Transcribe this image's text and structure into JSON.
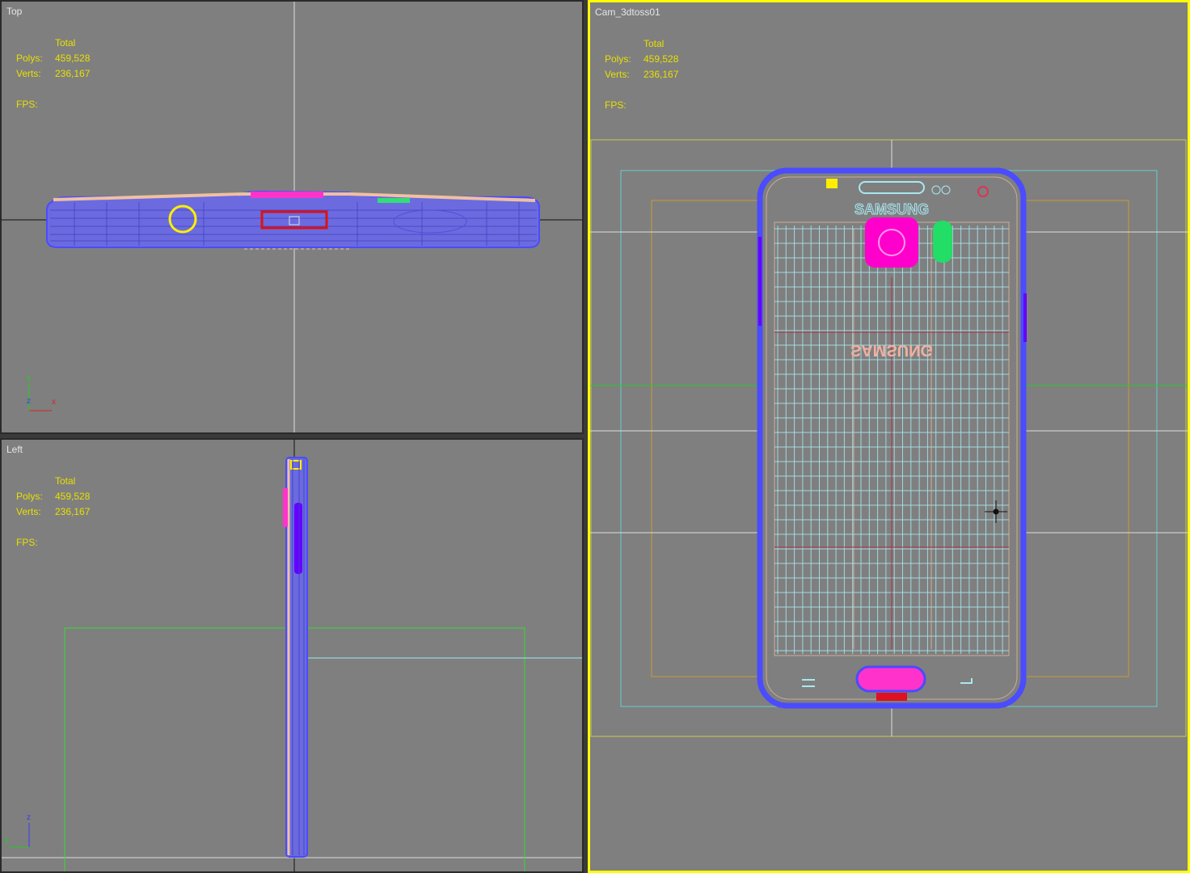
{
  "viewports": {
    "top": {
      "label": "Top",
      "stats": {
        "header": "Total",
        "polys_label": "Polys:",
        "polys": "459,528",
        "verts_label": "Verts:",
        "verts": "236,167",
        "fps_label": "FPS:"
      },
      "axes": {
        "up": "y",
        "mid": "z",
        "right": "x"
      }
    },
    "left": {
      "label": "Left",
      "stats": {
        "header": "Total",
        "polys_label": "Polys:",
        "polys": "459,528",
        "verts_label": "Verts:",
        "verts": "236,167",
        "fps_label": "FPS:"
      },
      "axes": {
        "up": "z",
        "mid": "",
        "right": "y"
      }
    },
    "camera": {
      "label": "Cam_3dtoss01",
      "stats": {
        "header": "Total",
        "polys_label": "Polys:",
        "polys": "459,528",
        "verts_label": "Verts:",
        "verts": "236,167",
        "fps_label": "FPS:"
      },
      "active": true
    }
  },
  "model": {
    "logo_text": "SAMSUNG"
  },
  "colors": {
    "viewport_bg": "#7f7f7f",
    "active_border": "#ffff00",
    "stats_text": "#e8e000",
    "wire_blue": "#5b5bff",
    "wire_peach": "#f0c0a0",
    "wire_cyan": "#a8e8f0",
    "camera_lens": "#ff00cc",
    "flash": "#22dd66"
  }
}
